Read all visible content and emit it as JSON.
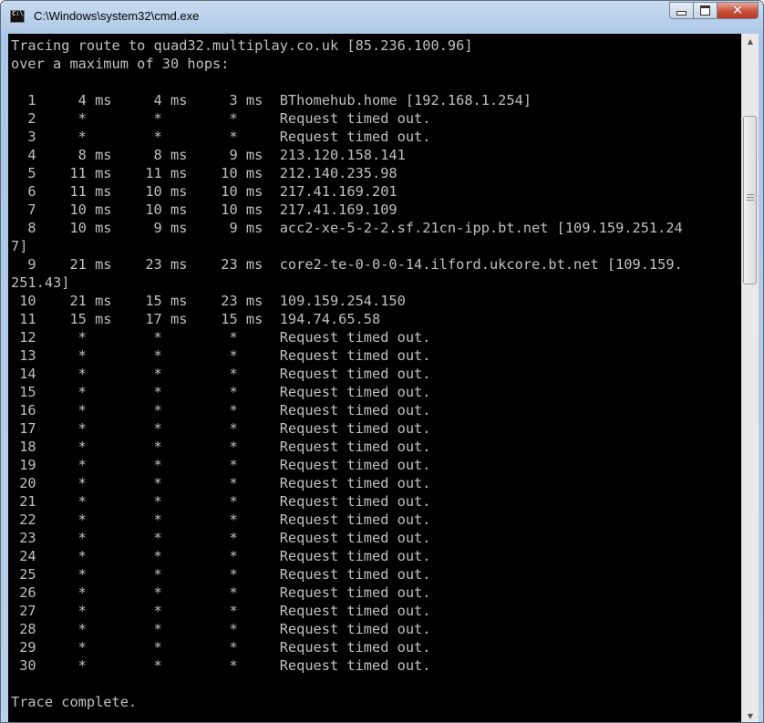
{
  "window": {
    "title": "C:\\Windows\\system32\\cmd.exe",
    "icon": "cmd-icon",
    "icon_text": "C:\\"
  },
  "controls": {
    "minimize": "minimize-icon",
    "maximize": "maximize-icon",
    "close": "close-icon",
    "close_glyph": "✕"
  },
  "console": {
    "text": "Tracing route to quad32.multiplay.co.uk [85.236.100.96]\nover a maximum of 30 hops:\n\n  1     4 ms     4 ms     3 ms  BThomehub.home [192.168.1.254]\n  2     *        *        *     Request timed out.\n  3     *        *        *     Request timed out.\n  4     8 ms     8 ms     9 ms  213.120.158.141\n  5    11 ms    11 ms    10 ms  212.140.235.98\n  6    11 ms    10 ms    10 ms  217.41.169.201\n  7    10 ms    10 ms    10 ms  217.41.169.109\n  8    10 ms     9 ms     9 ms  acc2-xe-5-2-2.sf.21cn-ipp.bt.net [109.159.251.24\n7]\n  9    21 ms    23 ms    23 ms  core2-te-0-0-0-14.ilford.ukcore.bt.net [109.159.\n251.43]\n 10    21 ms    15 ms    23 ms  109.159.254.150\n 11    15 ms    17 ms    15 ms  194.74.65.58\n 12     *        *        *     Request timed out.\n 13     *        *        *     Request timed out.\n 14     *        *        *     Request timed out.\n 15     *        *        *     Request timed out.\n 16     *        *        *     Request timed out.\n 17     *        *        *     Request timed out.\n 18     *        *        *     Request timed out.\n 19     *        *        *     Request timed out.\n 20     *        *        *     Request timed out.\n 21     *        *        *     Request timed out.\n 22     *        *        *     Request timed out.\n 23     *        *        *     Request timed out.\n 24     *        *        *     Request timed out.\n 25     *        *        *     Request timed out.\n 26     *        *        *     Request timed out.\n 27     *        *        *     Request timed out.\n 28     *        *        *     Request timed out.\n 29     *        *        *     Request timed out.\n 30     *        *        *     Request timed out.\n\nTrace complete.",
    "background": "#000000",
    "foreground": "#c0c0c0"
  },
  "scrollbar": {
    "up_glyph": "▲",
    "down_glyph": "▼",
    "position_fraction": 0.12
  }
}
